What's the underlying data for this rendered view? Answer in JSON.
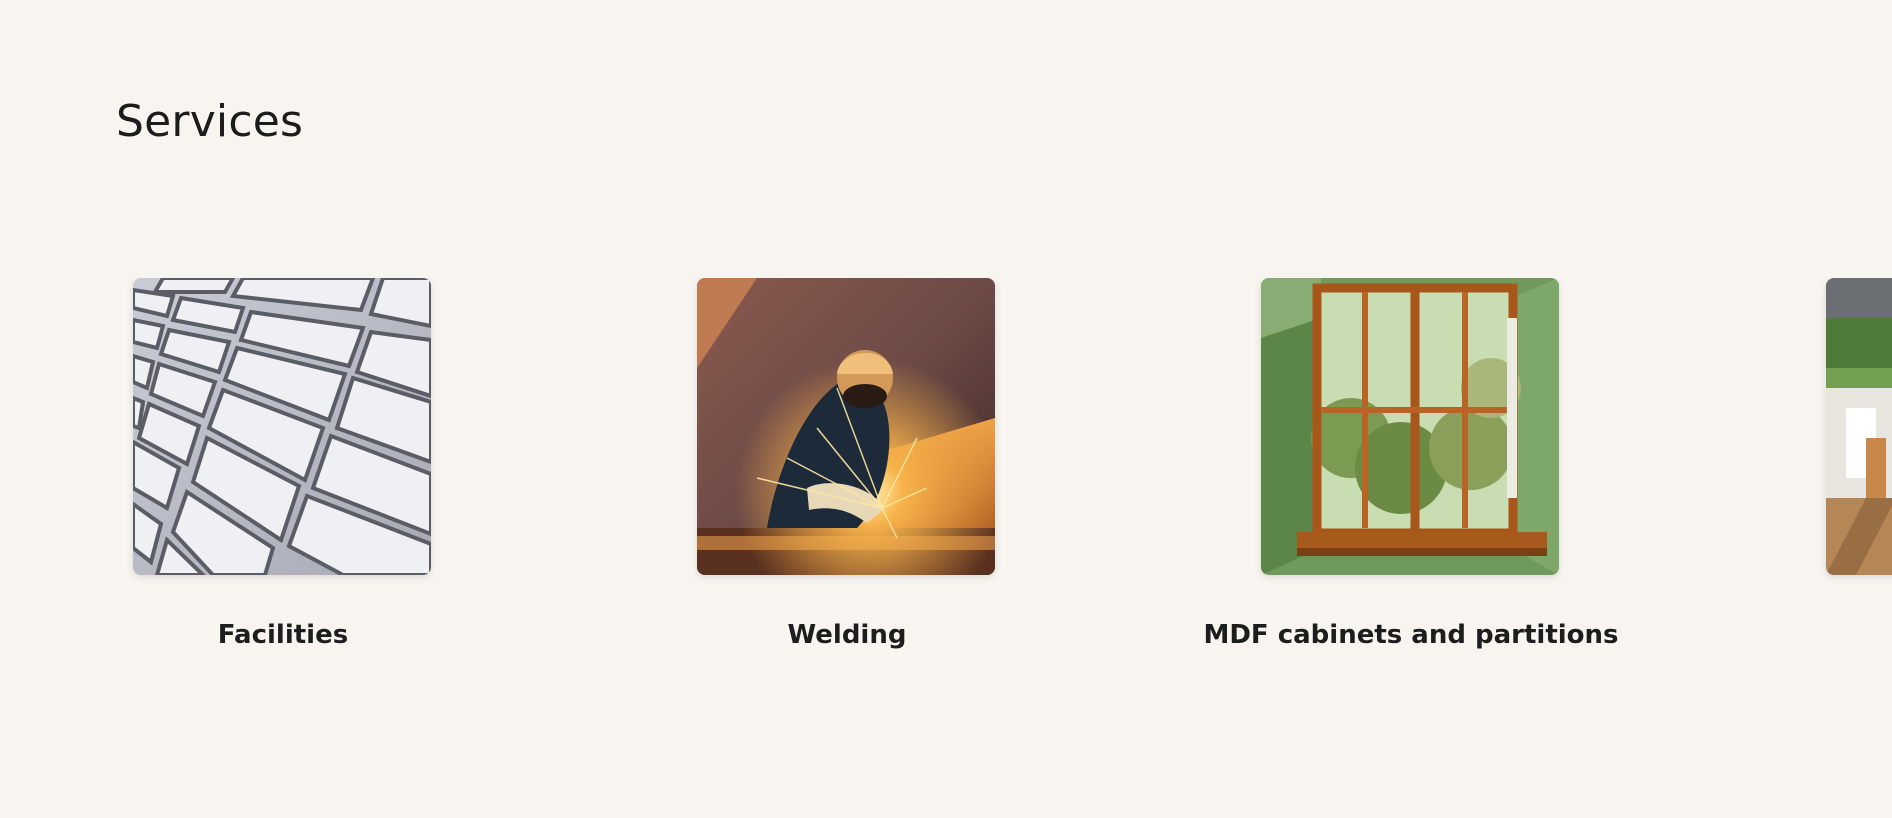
{
  "page": {
    "title": "Services",
    "background": "#f8f5f1"
  },
  "services": [
    {
      "label": "Facilities",
      "image": "white-brick-wall-photo"
    },
    {
      "label": "Welding",
      "image": "welder-sparks-photo"
    },
    {
      "label": "MDF cabinets and partitions",
      "image": "wooden-window-photo"
    },
    {
      "label": "",
      "image": "office-interior-photo"
    }
  ]
}
